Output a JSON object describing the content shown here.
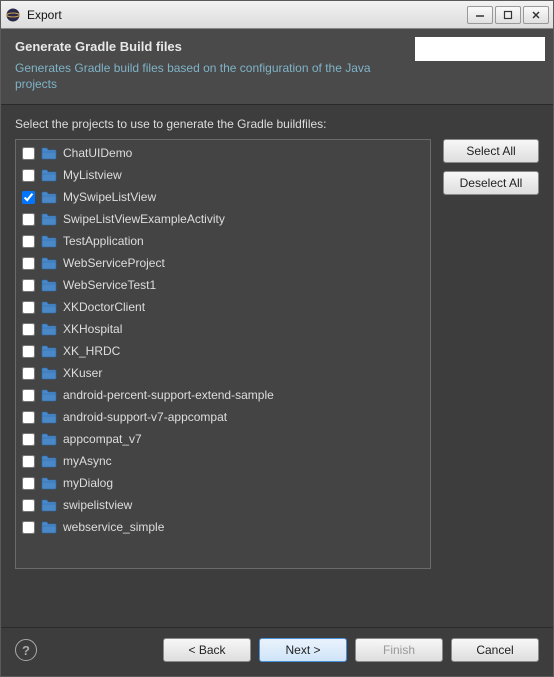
{
  "window": {
    "title": "Export"
  },
  "header": {
    "title": "Generate Gradle Build files",
    "description": "Generates Gradle build files based on the configuration of the Java projects"
  },
  "content": {
    "label": "Select the projects to use to generate the Gradle buildfiles:",
    "buttons": {
      "select_all": "Select All",
      "deselect_all": "Deselect All"
    }
  },
  "projects": [
    {
      "name": "ChatUIDemo",
      "checked": false
    },
    {
      "name": "MyListview",
      "checked": false
    },
    {
      "name": "MySwipeListView",
      "checked": true
    },
    {
      "name": "SwipeListViewExampleActivity",
      "checked": false
    },
    {
      "name": "TestApplication",
      "checked": false
    },
    {
      "name": "WebServiceProject",
      "checked": false
    },
    {
      "name": "WebServiceTest1",
      "checked": false
    },
    {
      "name": "XKDoctorClient",
      "checked": false
    },
    {
      "name": "XKHospital",
      "checked": false
    },
    {
      "name": "XK_HRDC",
      "checked": false
    },
    {
      "name": "XKuser",
      "checked": false
    },
    {
      "name": "android-percent-support-extend-sample",
      "checked": false
    },
    {
      "name": "android-support-v7-appcompat",
      "checked": false
    },
    {
      "name": "appcompat_v7",
      "checked": false
    },
    {
      "name": "myAsync",
      "checked": false
    },
    {
      "name": "myDialog",
      "checked": false
    },
    {
      "name": "swipelistview",
      "checked": false
    },
    {
      "name": "webservice_simple",
      "checked": false
    }
  ],
  "footer": {
    "back": "< Back",
    "next": "Next >",
    "finish": "Finish",
    "cancel": "Cancel"
  }
}
